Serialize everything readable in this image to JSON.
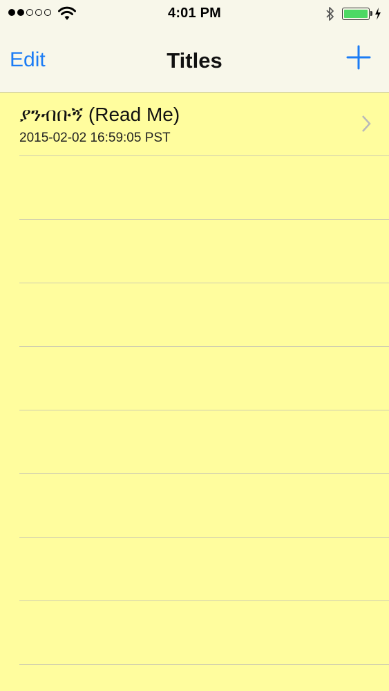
{
  "status_bar": {
    "time": "4:01 PM",
    "signal_bars_filled": 2,
    "signal_bars_total": 5,
    "battery_level": 1.0,
    "battery_color": "#4cd964",
    "icons": [
      "wifi-icon",
      "bluetooth-icon",
      "battery-icon",
      "charging-icon"
    ]
  },
  "nav": {
    "edit_label": "Edit",
    "title": "Titles",
    "add_icon": "plus-icon",
    "accent_color": "#1b7cf5"
  },
  "list": {
    "background_color": "#fffd9e",
    "items": [
      {
        "title": "ያንብቡኝ (Read Me)",
        "date": "2015-02-02 16:59:05 PST"
      }
    ],
    "empty_rows": 8
  }
}
